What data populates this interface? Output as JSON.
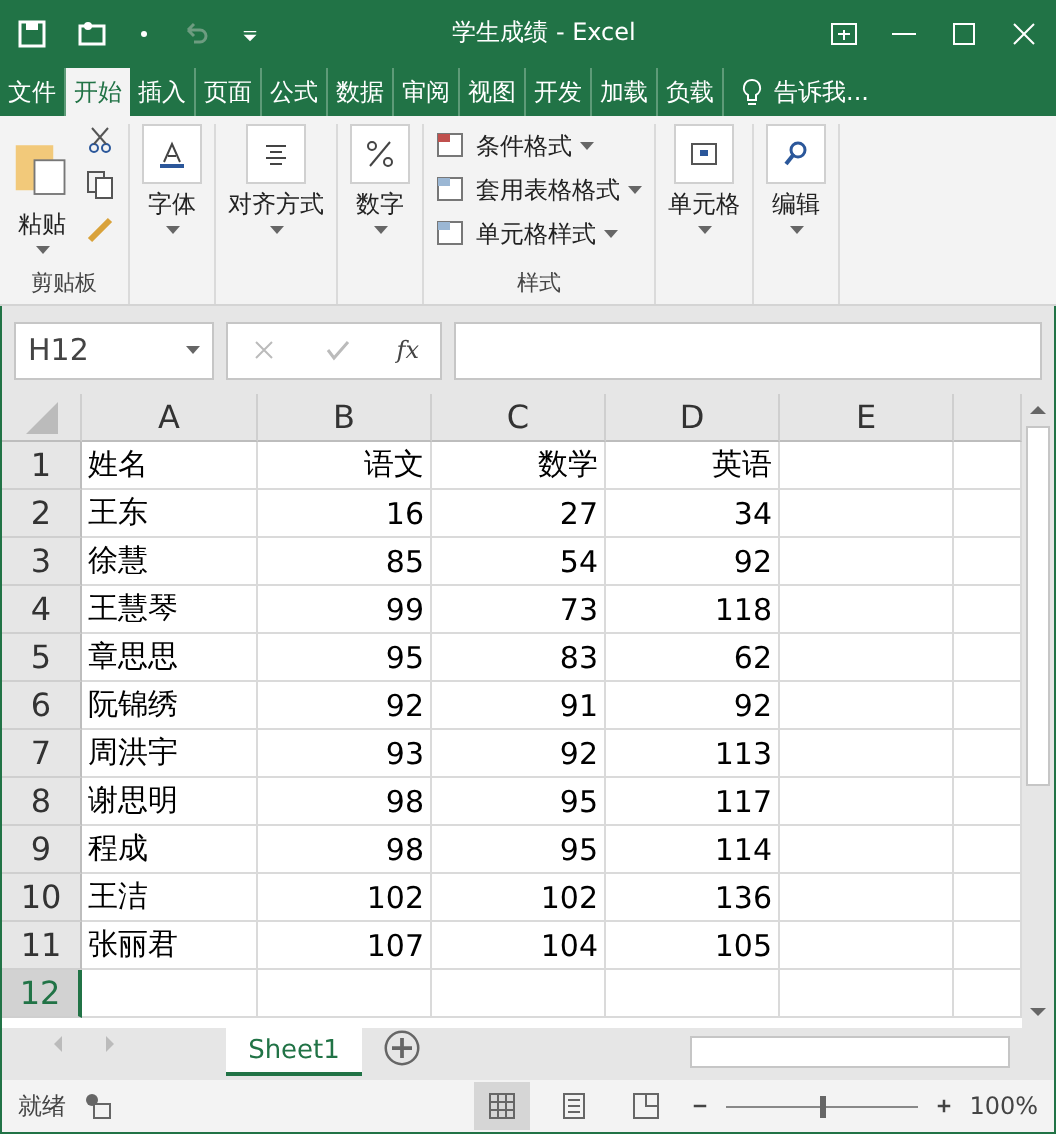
{
  "window": {
    "title": "学生成绩 - Excel"
  },
  "ribbon_tabs": [
    {
      "label": "文件",
      "selected": false
    },
    {
      "label": "开始",
      "selected": true
    },
    {
      "label": "插入",
      "selected": false
    },
    {
      "label": "页面",
      "selected": false
    },
    {
      "label": "公式",
      "selected": false
    },
    {
      "label": "数据",
      "selected": false
    },
    {
      "label": "审阅",
      "selected": false
    },
    {
      "label": "视图",
      "selected": false
    },
    {
      "label": "开发",
      "selected": false
    },
    {
      "label": "加载",
      "selected": false
    },
    {
      "label": "负载",
      "selected": false
    }
  ],
  "tell_me": "告诉我...",
  "ribbon": {
    "paste": "粘贴",
    "clipboard_group": "剪贴板",
    "font": "字体",
    "alignment": "对齐方式",
    "number": "数字",
    "styles": [
      "条件格式",
      "套用表格格式",
      "单元格样式"
    ],
    "styles_group": "样式",
    "cells": "单元格",
    "editing": "编辑"
  },
  "name_box": "H12",
  "fx": "fx",
  "columns": [
    "A",
    "B",
    "C",
    "D",
    "E"
  ],
  "rows": [
    {
      "num": "1",
      "cells": [
        "姓名",
        "语文",
        "数学",
        "英语"
      ],
      "selected": false
    },
    {
      "num": "2",
      "cells": [
        "王东",
        "16",
        "27",
        "34"
      ],
      "selected": false
    },
    {
      "num": "3",
      "cells": [
        "徐慧",
        "85",
        "54",
        "92"
      ],
      "selected": false
    },
    {
      "num": "4",
      "cells": [
        "王慧琴",
        "99",
        "73",
        "118"
      ],
      "selected": false
    },
    {
      "num": "5",
      "cells": [
        "章思思",
        "95",
        "83",
        "62"
      ],
      "selected": false
    },
    {
      "num": "6",
      "cells": [
        "阮锦绣",
        "92",
        "91",
        "92"
      ],
      "selected": false
    },
    {
      "num": "7",
      "cells": [
        "周洪宇",
        "93",
        "92",
        "113"
      ],
      "selected": false
    },
    {
      "num": "8",
      "cells": [
        "谢思明",
        "98",
        "95",
        "117"
      ],
      "selected": false
    },
    {
      "num": "9",
      "cells": [
        "程成",
        "98",
        "95",
        "114"
      ],
      "selected": false
    },
    {
      "num": "10",
      "cells": [
        "王洁",
        "102",
        "102",
        "136"
      ],
      "selected": false
    },
    {
      "num": "11",
      "cells": [
        "张丽君",
        "107",
        "104",
        "105"
      ],
      "selected": false
    },
    {
      "num": "12",
      "cells": [],
      "selected": true
    }
  ],
  "sheet_tabs": [
    {
      "label": "Sheet1",
      "selected": true
    }
  ],
  "status_bar": {
    "status": "就绪",
    "zoom": "100%",
    "zoom_slider": {
      "level": 0.5
    }
  }
}
